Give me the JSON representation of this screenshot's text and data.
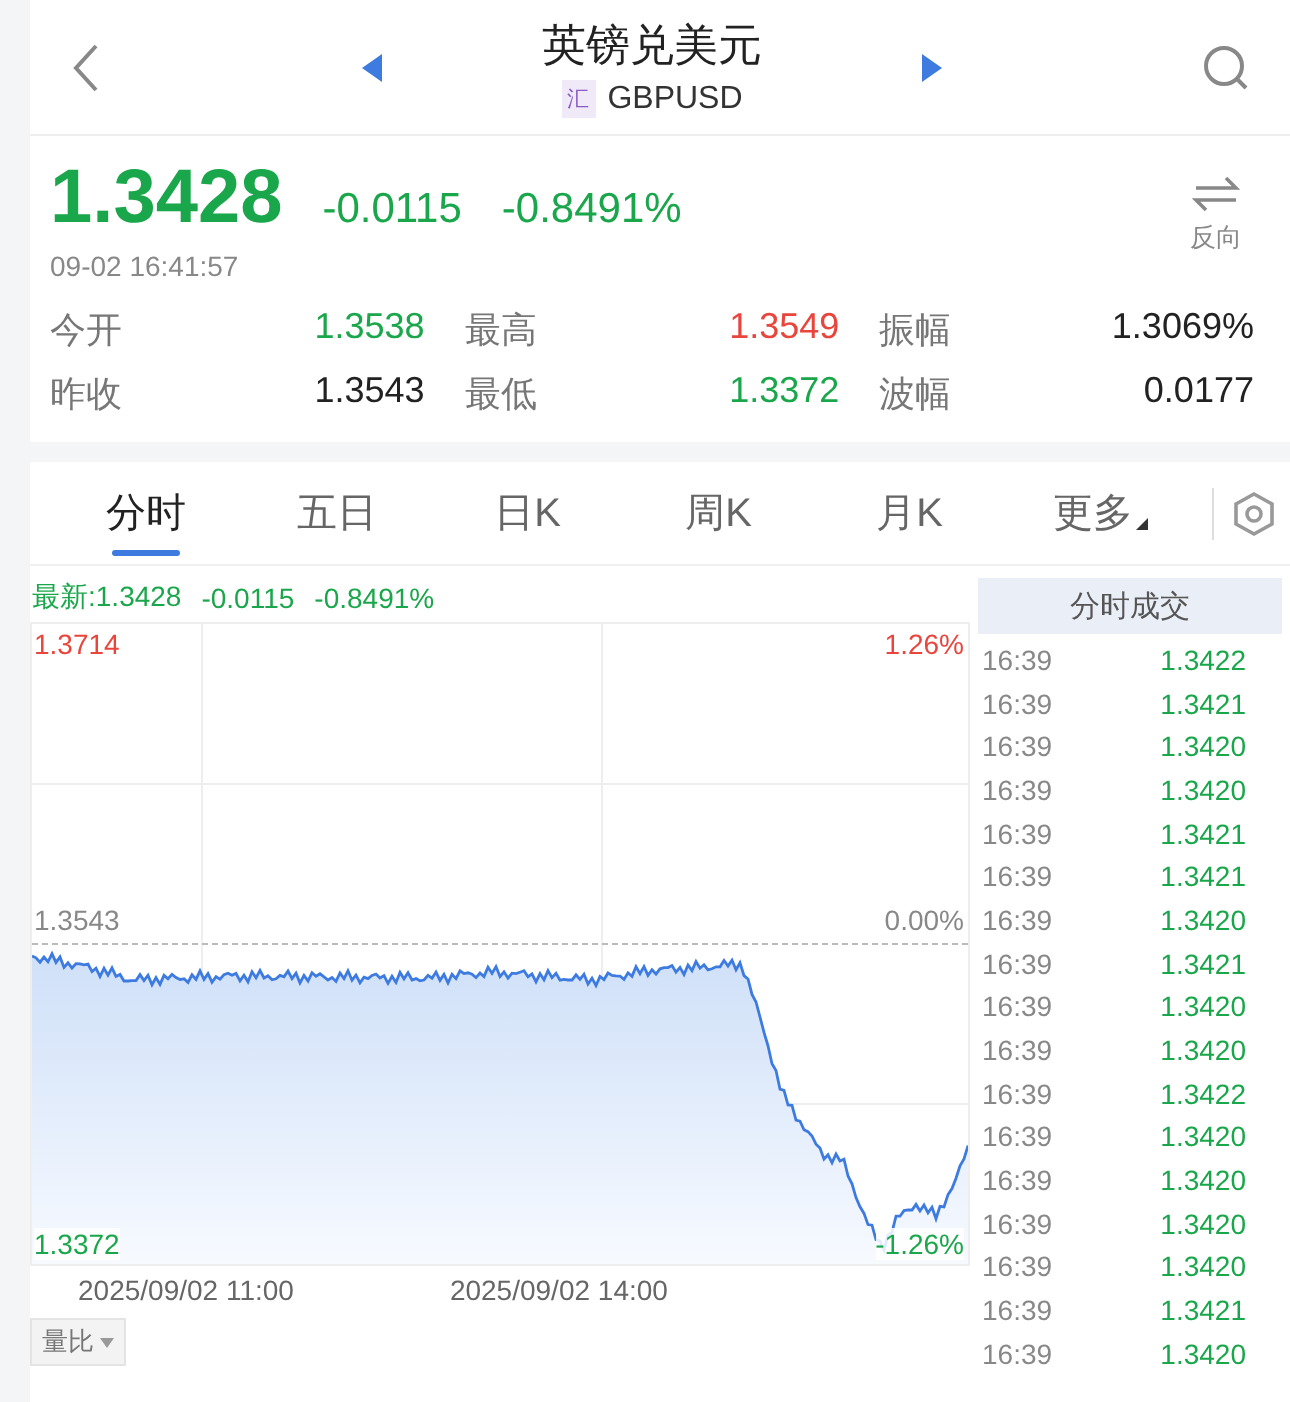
{
  "header": {
    "title": "英镑兑美元",
    "badge": "汇",
    "symbol": "GBPUSD"
  },
  "quote": {
    "price": "1.3428",
    "change": "-0.0115",
    "percent": "-0.8491%",
    "time": "09-02 16:41:57",
    "reverse_label": "反向"
  },
  "stats": [
    {
      "label": "今开",
      "value": "1.3538",
      "color": "#1aa64a"
    },
    {
      "label": "最高",
      "value": "1.3549",
      "color": "#e8453c"
    },
    {
      "label": "振幅",
      "value": "1.3069%",
      "color": "#222222"
    },
    {
      "label": "昨收",
      "value": "1.3543",
      "color": "#222222"
    },
    {
      "label": "最低",
      "value": "1.3372",
      "color": "#1aa64a"
    },
    {
      "label": "波幅",
      "value": "0.0177",
      "color": "#222222"
    }
  ],
  "tabs": [
    {
      "label": "分时",
      "selected": true
    },
    {
      "label": "五日",
      "selected": false
    },
    {
      "label": "日K",
      "selected": false
    },
    {
      "label": "周K",
      "selected": false
    },
    {
      "label": "月K",
      "selected": false
    },
    {
      "label": "更多",
      "selected": false
    }
  ],
  "chart": {
    "latest": "最新:1.3428",
    "latest_change": "-0.0115",
    "latest_percent": "-0.8491%",
    "y_high": "1.3714",
    "y_mid": "1.3543",
    "y_low": "1.3372",
    "pct_high": "1.26%",
    "pct_mid": "0.00%",
    "pct_low": "-1.26%",
    "x_labels": [
      "2025/09/02 11:00",
      "2025/09/02 14:00"
    ],
    "indicator": "量比"
  },
  "trades": {
    "title": "分时成交",
    "rows": [
      {
        "time": "16:39",
        "price": "1.3422"
      },
      {
        "time": "16:39",
        "price": "1.3421"
      },
      {
        "time": "16:39",
        "price": "1.3420"
      },
      {
        "time": "16:39",
        "price": "1.3420"
      },
      {
        "time": "16:39",
        "price": "1.3421"
      },
      {
        "time": "16:39",
        "price": "1.3421"
      },
      {
        "time": "16:39",
        "price": "1.3420"
      },
      {
        "time": "16:39",
        "price": "1.3421"
      },
      {
        "time": "16:39",
        "price": "1.3420"
      },
      {
        "time": "16:39",
        "price": "1.3420"
      },
      {
        "time": "16:39",
        "price": "1.3422"
      },
      {
        "time": "16:39",
        "price": "1.3420"
      },
      {
        "time": "16:39",
        "price": "1.3420"
      },
      {
        "time": "16:39",
        "price": "1.3420"
      },
      {
        "time": "16:39",
        "price": "1.3420"
      },
      {
        "time": "16:39",
        "price": "1.3421"
      },
      {
        "time": "16:39",
        "price": "1.3420"
      }
    ]
  }
}
